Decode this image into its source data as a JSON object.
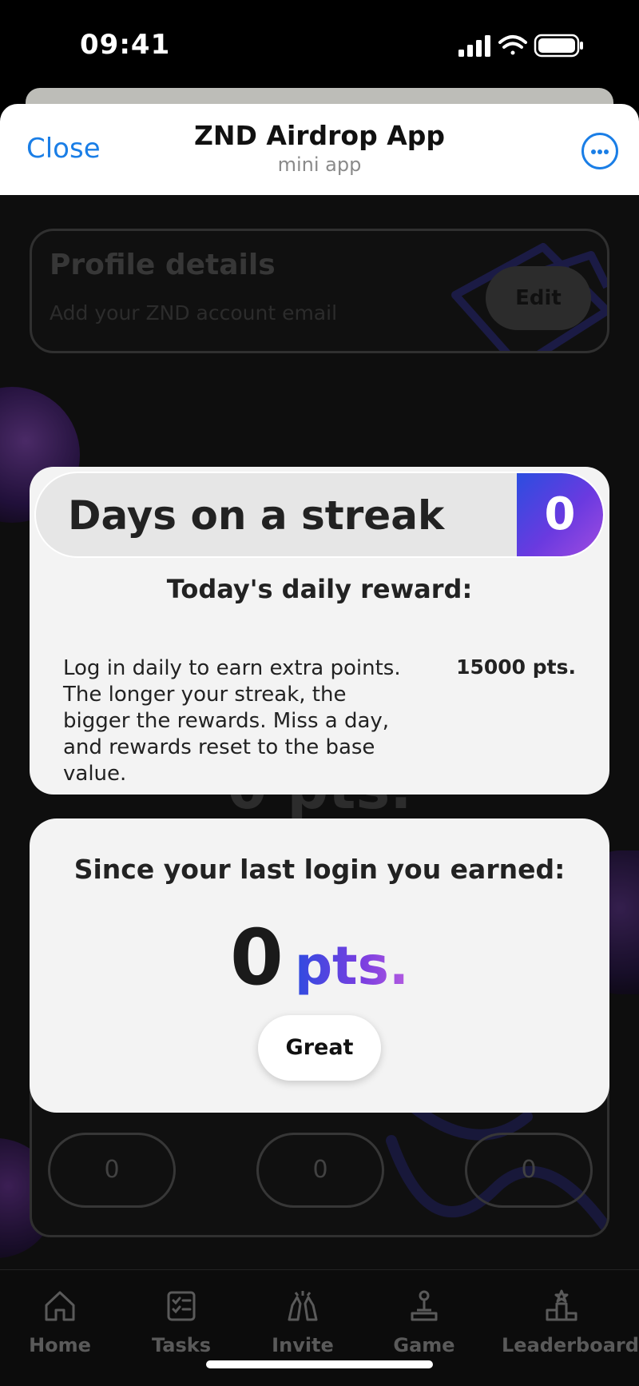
{
  "status_bar": {
    "time": "09:41"
  },
  "header": {
    "close_label": "Close",
    "title": "ZND Airdrop App",
    "subtitle": "mini app"
  },
  "profile": {
    "title": "Profile details",
    "email_placeholder": "Add your ZND account email",
    "edit_label": "Edit"
  },
  "background": {
    "stats": [
      "0",
      "0",
      "0"
    ],
    "ghost_value": "0 pts."
  },
  "streak_modal": {
    "title": "Days on a streak",
    "days": "0",
    "reward_title": "Today's daily reward:",
    "description": "Log in daily to earn extra points. The longer your streak, the bigger the rewards. Miss a day, and rewards reset to the base value.",
    "reward_points": "15000 pts."
  },
  "login_modal": {
    "title": "Since your last login you earned:",
    "earned_value": "0",
    "earned_unit": "pts.",
    "button_label": "Great"
  },
  "tabs": [
    {
      "label": "Home",
      "icon": "home-icon"
    },
    {
      "label": "Tasks",
      "icon": "tasks-icon"
    },
    {
      "label": "Invite",
      "icon": "invite-icon"
    },
    {
      "label": "Game",
      "icon": "joystick-icon"
    },
    {
      "label": "Leaderboard",
      "icon": "leaderboard-icon"
    }
  ],
  "colors": {
    "accent_blue": "#1a7ee6",
    "gradient_start": "#2f4be0",
    "gradient_end": "#b55ce0"
  }
}
